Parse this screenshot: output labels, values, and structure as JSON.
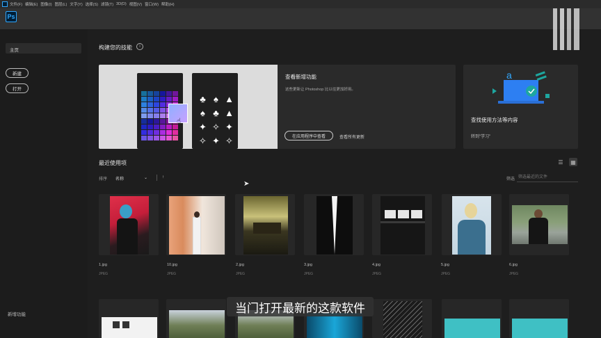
{
  "menubar": {
    "items": [
      "文件(F)",
      "编辑(E)",
      "图像(I)",
      "图层(L)",
      "文字(Y)",
      "选择(S)",
      "滤镜(T)",
      "3D(D)",
      "视图(V)",
      "窗口(W)",
      "帮助(H)"
    ]
  },
  "app": {
    "logo": "Ps"
  },
  "sidebar": {
    "home": "主页",
    "new_btn": "新建",
    "open_btn": "打开",
    "new_features": "新增功能"
  },
  "skills": {
    "title": "构建您的技能",
    "info": "i",
    "feature": {
      "heading": "查看新增功能",
      "desc": "这些更新让 Photoshop 比以往更加好用。",
      "view_in_app": "在应用程序中查看",
      "view_all": "查看所有更新"
    },
    "learn": {
      "heading": "查找使用方法等内容",
      "link": "转到\"学习\""
    }
  },
  "recent": {
    "title": "最近使用项",
    "sort_label": "排序",
    "sort_value": "名称",
    "sort_arrow": "↑",
    "filter_label": "筛选",
    "filter_placeholder": "筛选最近的文件",
    "files": [
      {
        "name": "1.jpg",
        "type": "JPEG"
      },
      {
        "name": "10.jpg",
        "type": "JPEG"
      },
      {
        "name": "2.jpg",
        "type": "JPEG"
      },
      {
        "name": "3.jpg",
        "type": "JPEG"
      },
      {
        "name": "4.jpg",
        "type": "JPEG"
      },
      {
        "name": "5.jpg",
        "type": "JPEG"
      },
      {
        "name": "6.jpg",
        "type": "JPEG"
      }
    ]
  },
  "caption": "当门打开最新的这款软件",
  "colors": {
    "ps_blue": "#31a8ff",
    "ps_navy": "#001e36",
    "accent_teal": "#1ea7a0"
  }
}
